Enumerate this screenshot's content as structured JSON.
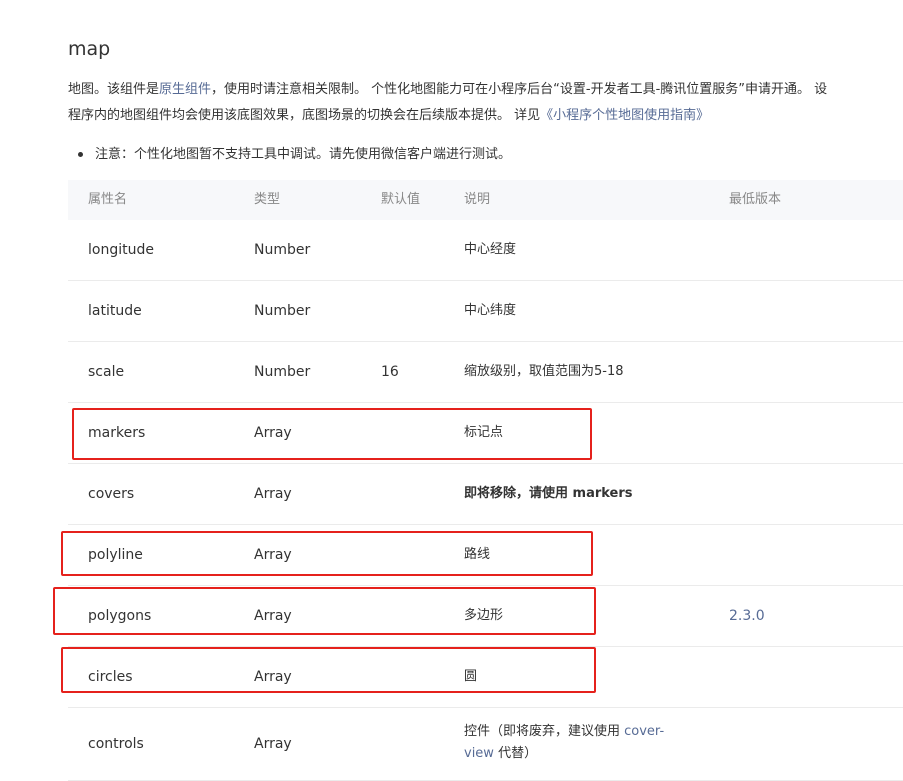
{
  "title": "map",
  "intro": {
    "p1": "地图。该组件是",
    "native_link": "原生组件",
    "p2": "，使用时请注意相关限制。 个性化地图能力可在小程序后台“设置-开发者工具-腾讯位置服务”申请开通。 设",
    "p3": "程序内的地图组件均会使用该底图效果，底图场景的切换会在后续版本提供。 详见",
    "guide_link": "《小程序个性地图使用指南》"
  },
  "note": "注意：个性化地图暂不支持工具中调试。请先使用微信客户端进行测试。",
  "table": {
    "headers": {
      "name": "属性名",
      "type": "类型",
      "default": "默认值",
      "desc": "说明",
      "version": "最低版本"
    },
    "rows": [
      {
        "name": "longitude",
        "type": "Number",
        "default": "",
        "desc": "中心经度",
        "version": ""
      },
      {
        "name": "latitude",
        "type": "Number",
        "default": "",
        "desc": "中心纬度",
        "version": ""
      },
      {
        "name": "scale",
        "type": "Number",
        "default": "16",
        "desc": "缩放级别，取值范围为5-18",
        "version": ""
      },
      {
        "name": "markers",
        "type": "Array",
        "default": "",
        "desc": "标记点",
        "version": ""
      },
      {
        "name": "covers",
        "type": "Array",
        "default": "",
        "desc": "即将移除，请使用 markers",
        "version": ""
      },
      {
        "name": "polyline",
        "type": "Array",
        "default": "",
        "desc": "路线",
        "version": ""
      },
      {
        "name": "polygons",
        "type": "Array",
        "default": "",
        "desc": "多边形",
        "version": "2.3.0"
      },
      {
        "name": "circles",
        "type": "Array",
        "default": "",
        "desc": "圆",
        "version": ""
      },
      {
        "name": "controls",
        "type": "Array",
        "default": "",
        "desc_pre": "控件（即将废弃，建议使用 ",
        "desc_link1": "cover-",
        "desc_link2": "view",
        "desc_post": " 代替）",
        "version": ""
      }
    ]
  },
  "colors": {
    "highlight": "#e5211c",
    "link": "#576b95",
    "header_bg": "#f7f8fa"
  }
}
